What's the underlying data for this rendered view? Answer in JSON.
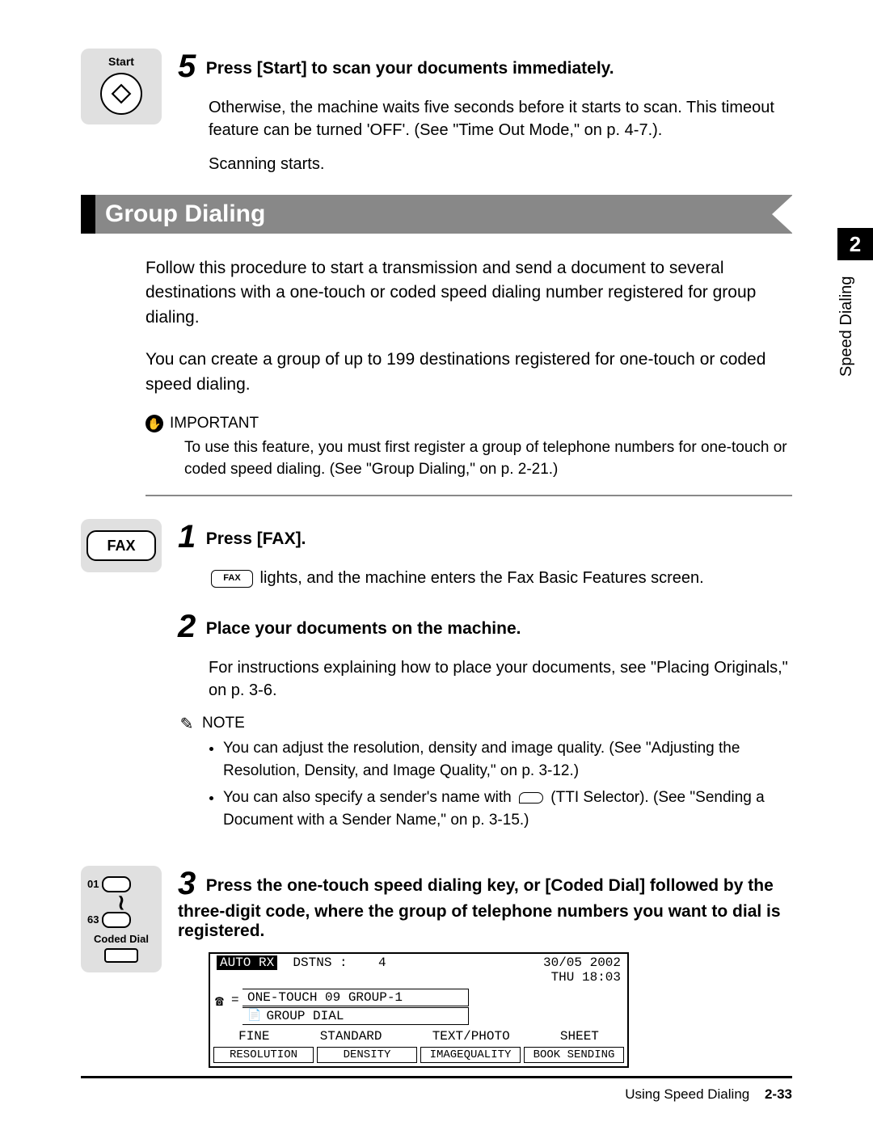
{
  "sidetab": {
    "chapter": "2",
    "label": "Speed Dialing"
  },
  "step5": {
    "keylabel": "Start",
    "num": "5",
    "title": "Press [Start] to scan your documents immediately.",
    "para1": "Otherwise, the machine waits five seconds before it starts to scan. This timeout feature can be turned 'OFF'. (See \"Time Out Mode,\" on p. 4-7.).",
    "para2": "Scanning starts."
  },
  "section": {
    "title": "Group Dialing"
  },
  "intro": {
    "p1": "Follow this procedure to start a transmission and send a document to several destinations with a one-touch or coded speed dialing number registered for group dialing.",
    "p2": "You can create a group of up to 199 destinations registered for one-touch or coded speed dialing."
  },
  "important": {
    "label": "IMPORTANT",
    "text": "To use this feature, you must first register a group of telephone numbers for one-touch or coded speed dialing. (See \"Group Dialing,\" on p. 2-21.)"
  },
  "step1": {
    "keylabel": "FAX",
    "num": "1",
    "title": "Press [FAX].",
    "small_fax": "FAX",
    "text": " lights, and the machine enters the Fax Basic Features screen."
  },
  "step2": {
    "num": "2",
    "title": "Place your documents on the machine.",
    "text": "For instructions explaining how to place your documents, see \"Placing Originals,\" on p. 3-6.",
    "note_label": "NOTE",
    "bullets": [
      "You can adjust the resolution, density and image quality. (See \"Adjusting the Resolution, Density, and Image Quality,\" on p. 3-12.)",
      "You can also specify a sender's name with  (TTI Selector). (See \"Sending a Document with a Sender Name,\" on p. 3-15.)"
    ],
    "bullet2_pre": "You can also specify a sender's name with ",
    "bullet2_post": " (TTI Selector). (See \"Sending a Document with a Sender Name,\" on p. 3-15.)"
  },
  "step3": {
    "num": "3",
    "title": "Press the one-touch speed dialing key, or [Coded Dial] followed by the three-digit code, where the group of telephone numbers you want to dial is registered.",
    "key_top": "01",
    "key_bot": "63",
    "key_label": "Coded Dial"
  },
  "lcd": {
    "auto_rx": "AUTO RX",
    "dstns": "DSTNS :",
    "dstns_n": "4",
    "date": "30/05 2002",
    "time": "THU 18:03",
    "line1": "ONE-TOUCH   09 GROUP-1",
    "line2": "            GROUP DIAL",
    "s1": "FINE",
    "s2": "STANDARD",
    "s3": "TEXT/PHOTO",
    "s4": "SHEET",
    "b1": "RESOLUTION",
    "b2": "DENSITY",
    "b3": "IMAGEQUALITY",
    "b4": "BOOK SENDING"
  },
  "footer": {
    "section": "Using Speed Dialing",
    "page": "2-33"
  }
}
